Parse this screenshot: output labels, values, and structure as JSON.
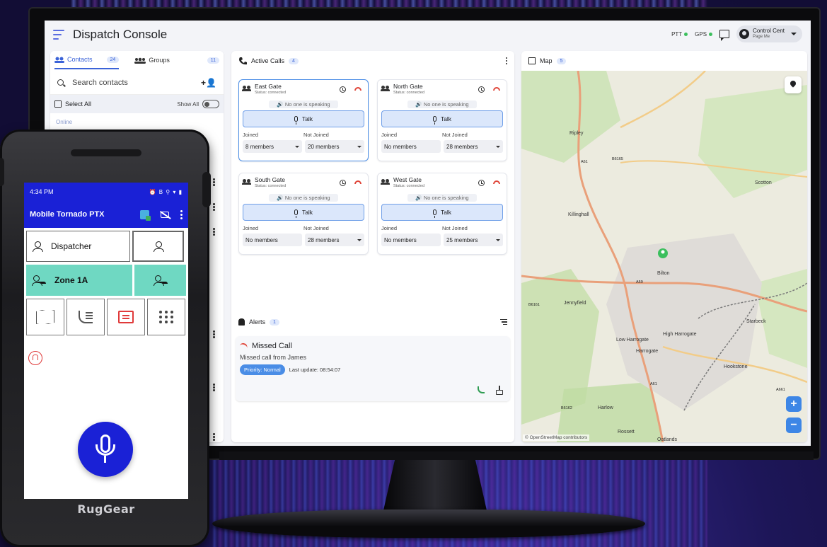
{
  "app": {
    "title": "Dispatch Console"
  },
  "header": {
    "ptt_label": "PTT",
    "gps_label": "GPS",
    "user_name": "Control Cent",
    "user_sub": "Page Me",
    "status_color": "#3bbf5d"
  },
  "contacts": {
    "tab_contacts": "Contacts",
    "contacts_count": "24",
    "tab_groups": "Groups",
    "groups_count": "11",
    "search_placeholder": "Search contacts",
    "select_all": "Select All",
    "show_all": "Show All",
    "online_label": "Online"
  },
  "active_calls": {
    "title": "Active Calls",
    "count": "4",
    "calls": [
      {
        "name": "East Gate",
        "status": "Status: connected",
        "speaking": "No one is speaking",
        "talk": "Talk",
        "joined_label": "Joined",
        "not_joined_label": "Not Joined",
        "joined": "8 members",
        "not_joined": "20 members"
      },
      {
        "name": "North Gate",
        "status": "Status: connected",
        "speaking": "No one is speaking",
        "talk": "Talk",
        "joined_label": "Joined",
        "not_joined_label": "Not Joined",
        "joined": "No members",
        "not_joined": "28 members"
      },
      {
        "name": "South Gate",
        "status": "Status: connected",
        "speaking": "No one is speaking",
        "talk": "Talk",
        "joined_label": "Joined",
        "not_joined_label": "Not Joined",
        "joined": "No members",
        "not_joined": "28 members"
      },
      {
        "name": "West Gate",
        "status": "Status: connected",
        "speaking": "No one is speaking",
        "talk": "Talk",
        "joined_label": "Joined",
        "not_joined_label": "Not Joined",
        "joined": "No members",
        "not_joined": "25 members"
      }
    ]
  },
  "alerts": {
    "title": "Alerts",
    "count": "1",
    "item": {
      "title": "Missed Call",
      "body": "Missed call from James",
      "priority": "Priority: Normal",
      "updated": "Last update: 08:54:07"
    }
  },
  "map": {
    "title": "Map",
    "count": "5",
    "attribution": "© OpenStreetMap contributors",
    "zoom_in": "+",
    "zoom_out": "−",
    "places": [
      "Ripley",
      "Scotton",
      "Killinghall",
      "Bilton",
      "Jennyfield",
      "Starbeck",
      "High Harrogate",
      "Low Harrogate",
      "Harrogate",
      "Hookstone",
      "Harlow",
      "Rossett",
      "Oatlands"
    ],
    "roads": [
      "A61",
      "B6165",
      "A59",
      "B6161",
      "A661",
      "B6162",
      "A61"
    ]
  },
  "mobile": {
    "time": "4:34 PM",
    "status_icons": "⏰ B ⚲ ▾ ▮",
    "app_title": "Mobile Tornado PTX",
    "dispatcher": "Dispatcher",
    "zone": "Zone 1A",
    "brand": "RugGear"
  }
}
